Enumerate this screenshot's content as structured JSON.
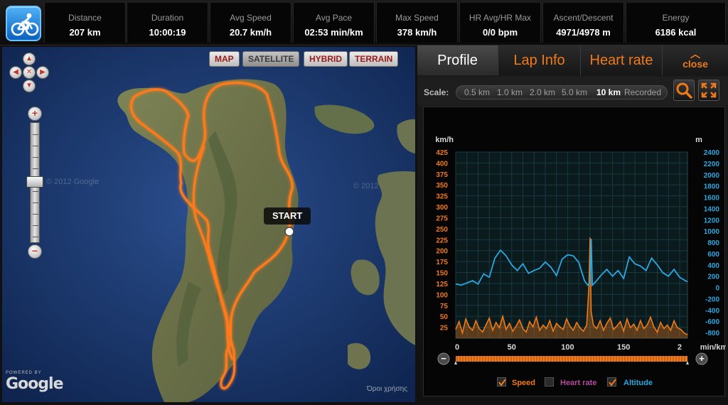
{
  "stats": [
    {
      "label": "Distance",
      "value": "207 km"
    },
    {
      "label": "Duration",
      "value": "10:00:19"
    },
    {
      "label": "Avg Speed",
      "value": "20.7 km/h"
    },
    {
      "label": "Avg Pace",
      "value": "02:53 min/km"
    },
    {
      "label": "Max Speed",
      "value": "378 km/h"
    },
    {
      "label": "HR Avg/HR Max",
      "value": "0/0 bpm"
    },
    {
      "label": "Ascent/Descent",
      "value": "4971/4978 m"
    },
    {
      "label": "Energy",
      "value": "6186 kcal"
    }
  ],
  "app_icon": "cyclist-icon",
  "map": {
    "types": [
      {
        "label": "MAP",
        "active": false
      },
      {
        "label": "SATELLITE",
        "active": true
      },
      {
        "label": "HYBRID",
        "active": false
      },
      {
        "label": "TERRAIN",
        "active": false
      }
    ],
    "start_label": "START",
    "powered_by": "POWERED BY",
    "logo_text": "Google",
    "copyright": "Όροι χρήσης",
    "watermarks": [
      "© 2012 Google",
      "© 2012"
    ],
    "route_color": "#ff7a1a"
  },
  "panel": {
    "tabs": [
      {
        "label": "Profile",
        "active": true
      },
      {
        "label": "Lap Info",
        "active": false
      },
      {
        "label": "Heart rate",
        "active": false
      }
    ],
    "close_label": "close",
    "scale_label": "Scale:",
    "scale_options": [
      {
        "label": "0.5 km",
        "active": false
      },
      {
        "label": "1.0 km",
        "active": false
      },
      {
        "label": "2.0 km",
        "active": false
      },
      {
        "label": "5.0 km",
        "active": false
      },
      {
        "label": "10 km",
        "active": true
      },
      {
        "label": "Recorded",
        "active": false
      }
    ],
    "zoom_icon": "magnifier-icon",
    "fullscreen_icon": "fullscreen-icon"
  },
  "chart_data": {
    "type": "line",
    "left_axis_unit": "km/h",
    "right_axis_unit": "m",
    "x_unit": "min/km",
    "left_ticks": [
      25,
      50,
      75,
      100,
      125,
      150,
      175,
      200,
      225,
      250,
      275,
      300,
      325,
      350,
      375,
      400,
      425
    ],
    "right_ticks": [
      -800,
      -600,
      -400,
      -200,
      0,
      200,
      400,
      600,
      800,
      1000,
      1200,
      1400,
      1600,
      1800,
      2000,
      2200,
      2400
    ],
    "x_ticks": [
      "0",
      "50",
      "100",
      "150",
      "2"
    ],
    "xlim": [
      0,
      207
    ],
    "ylim_left": [
      0,
      425
    ],
    "ylim_right": [
      -900,
      2400
    ],
    "grid": true,
    "colors": {
      "speed": "#f07a1a",
      "altitude": "#2aa8e0",
      "heart_rate": "#b44a9a"
    },
    "series": [
      {
        "name": "Speed",
        "axis": "left",
        "x": [
          0,
          3,
          6,
          9,
          12,
          15,
          18,
          21,
          24,
          27,
          30,
          33,
          36,
          39,
          42,
          45,
          48,
          51,
          54,
          57,
          60,
          63,
          66,
          69,
          72,
          75,
          78,
          81,
          84,
          87,
          90,
          93,
          96,
          99,
          102,
          105,
          108,
          111,
          114,
          117,
          119,
          120,
          121,
          123,
          126,
          129,
          132,
          135,
          138,
          141,
          144,
          147,
          150,
          153,
          156,
          159,
          162,
          165,
          168,
          171,
          174,
          177,
          180,
          183,
          186,
          189,
          192,
          195,
          198,
          201,
          204,
          207
        ],
        "y": [
          20,
          38,
          12,
          44,
          26,
          18,
          40,
          22,
          14,
          30,
          46,
          18,
          36,
          24,
          50,
          20,
          34,
          16,
          28,
          42,
          22,
          14,
          38,
          26,
          48,
          18,
          30,
          22,
          40,
          16,
          34,
          26,
          20,
          44,
          28,
          18,
          36,
          24,
          16,
          30,
          120,
          230,
          60,
          30,
          22,
          40,
          18,
          34,
          46,
          20,
          28,
          38,
          16,
          44,
          24,
          32,
          18,
          40,
          22,
          30,
          48,
          26,
          14,
          36,
          22,
          30,
          18,
          40,
          24,
          20,
          12,
          8
        ]
      },
      {
        "name": "Altitude",
        "axis": "right",
        "x": [
          0,
          5,
          10,
          15,
          20,
          25,
          30,
          35,
          40,
          45,
          50,
          55,
          60,
          65,
          70,
          75,
          80,
          85,
          90,
          95,
          100,
          105,
          110,
          115,
          118,
          120,
          121,
          122,
          125,
          130,
          135,
          140,
          145,
          150,
          155,
          160,
          165,
          170,
          175,
          180,
          185,
          190,
          195,
          200,
          205,
          207
        ],
        "y": [
          60,
          40,
          80,
          120,
          60,
          240,
          180,
          520,
          660,
          560,
          400,
          300,
          420,
          250,
          300,
          340,
          450,
          360,
          210,
          500,
          580,
          560,
          440,
          120,
          40,
          80,
          860,
          40,
          100,
          220,
          320,
          200,
          300,
          160,
          540,
          420,
          380,
          300,
          520,
          400,
          260,
          200,
          320,
          180,
          120,
          100
        ]
      },
      {
        "name": "Heart rate",
        "axis": "left",
        "visible": false,
        "x": [],
        "y": []
      }
    ],
    "legend": [
      {
        "name": "Speed",
        "checked": true
      },
      {
        "name": "Heart rate",
        "checked": false
      },
      {
        "name": "Altitude",
        "checked": true
      }
    ]
  }
}
